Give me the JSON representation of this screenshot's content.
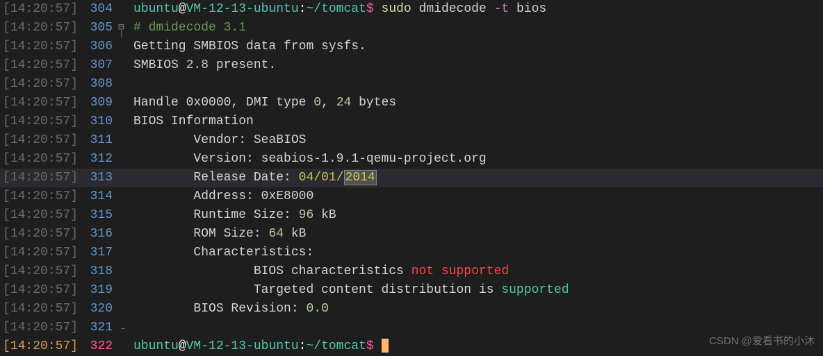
{
  "timestamp": "14:20:57",
  "watermark": "CSDN @爱看书的小沐",
  "lines": [
    {
      "num": "304",
      "fold": "none"
    },
    {
      "num": "305",
      "fold": "start"
    },
    {
      "num": "306",
      "fold": "mid"
    },
    {
      "num": "307",
      "fold": "mid"
    },
    {
      "num": "308",
      "fold": "mid"
    },
    {
      "num": "309",
      "fold": "mid"
    },
    {
      "num": "310",
      "fold": "mid"
    },
    {
      "num": "311",
      "fold": "mid"
    },
    {
      "num": "312",
      "fold": "mid"
    },
    {
      "num": "313",
      "fold": "mid",
      "hl": true
    },
    {
      "num": "314",
      "fold": "mid"
    },
    {
      "num": "315",
      "fold": "mid"
    },
    {
      "num": "316",
      "fold": "mid"
    },
    {
      "num": "317",
      "fold": "mid"
    },
    {
      "num": "318",
      "fold": "mid"
    },
    {
      "num": "319",
      "fold": "mid"
    },
    {
      "num": "320",
      "fold": "mid"
    },
    {
      "num": "321",
      "fold": "end"
    },
    {
      "num": "322",
      "fold": "none",
      "tsOrange": true
    }
  ],
  "prompt": {
    "user": "ubuntu",
    "at": "@",
    "host": "VM-12-13-ubuntu",
    "colon": ":",
    "path": "~/tomcat",
    "dollar": "$"
  },
  "cmd": {
    "sudo": "sudo",
    "dmidecode": "dmidecode",
    "flag": "-t",
    "arg": "bios"
  },
  "output": {
    "comment": "# dmidecode 3.1",
    "getting": "Getting SMBIOS data from sysfs.",
    "smbios": "SMBIOS",
    "smbios_ver": "2.8",
    "present": "present.",
    "handle": "Handle 0x0000, DMI type",
    "handle_v1": "0",
    "handle_c": ",",
    "handle_v2": "24",
    "handle_bytes": "bytes",
    "bios_info": "BIOS Information",
    "vendor_k": "Vendor:",
    "vendor_v": "SeaBIOS",
    "version_k": "Version:",
    "version_v": "seabios-1.9.1-qemu-project.org",
    "release_k": "Release Date:",
    "release_d1": "04",
    "release_s": "/",
    "release_d2": "01",
    "release_d3": "2014",
    "address_k": "Address:",
    "address_v": "0xE8000",
    "runtime_k": "Runtime Size:",
    "runtime_n": "96",
    "runtime_u": "kB",
    "rom_k": "ROM Size:",
    "rom_n": "64",
    "rom_u": "kB",
    "char_k": "Characteristics:",
    "char1a": "BIOS characteristics",
    "char1b": "not",
    "char1c": "supported",
    "char2a": "Targeted content distribution is",
    "char2b": "supported",
    "rev_k": "BIOS Revision:",
    "rev_v": "0.0"
  }
}
